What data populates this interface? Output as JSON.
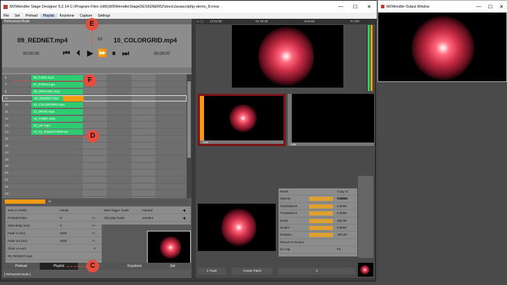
{
  "window": {
    "title": "MXWendler Stage Designer 5.2.14 C:\\Program Files (x86)\\MXWendlerStageDESIGNER52\\docs\\Javascript\\js-demo_8.mxw",
    "min": "—",
    "max": "☐",
    "close": "✕"
  },
  "menu": [
    "File",
    "Set",
    "Preload",
    "Playlist",
    "Keystone",
    "Capture",
    "Settings"
  ],
  "menu_active": "Playlist",
  "left": {
    "mode": "Rehearsal Mode",
    "clip_current": "09_REDNET.mp4",
    "clip_next": "10_COLORGRID.mp4",
    "index": "10",
    "time_current": "00:00:00",
    "time_next": "00:00:07",
    "rows": [
      {
        "n": "6",
        "clip": "06_FADE.mp4"
      },
      {
        "n": "7",
        "clip": "07_PIPES.mp4"
      },
      {
        "n": "8",
        "clip": "08_ORGANIC.mp4"
      },
      {
        "n": "9",
        "clip": "09_REDNET.mp4"
      },
      {
        "n": "10",
        "clip": "10_COLORGRID.mp4"
      },
      {
        "n": "11",
        "clip": "11_DROS.mp4"
      },
      {
        "n": "12",
        "clip": "12_CUBIC.mp4"
      },
      {
        "n": "13",
        "clip": "13_US.mp4"
      },
      {
        "n": "14",
        "clip": "14_14_KeyedLTHEM.avi"
      },
      {
        "n": "15",
        "clip": ""
      },
      {
        "n": "16",
        "clip": ""
      },
      {
        "n": "17",
        "clip": ""
      },
      {
        "n": "18",
        "clip": ""
      },
      {
        "n": "19",
        "clip": ""
      },
      {
        "n": "20",
        "clip": ""
      },
      {
        "n": "21",
        "clip": ""
      },
      {
        "n": "22",
        "clip": ""
      },
      {
        "n": "23",
        "clip": ""
      }
    ],
    "scroll_label": "16",
    "props": [
      {
        "label": "Text or media",
        "value": "media",
        "arrow": ""
      },
      {
        "label": "Preload Index",
        "value": "9",
        "arrow": "+ -"
      },
      {
        "label": "Start delay (ms)",
        "value": "0",
        "arrow": "+ -"
      },
      {
        "label": "Fade in (ms)",
        "value": "2000",
        "arrow": "+ -"
      },
      {
        "label": "Fade out (ms)",
        "value": "2000",
        "arrow": "+ -"
      },
      {
        "label": "Clear on end",
        "value": "",
        "arrow": "✓"
      },
      {
        "label": "09_REDNET.mp4",
        "value": "",
        "arrow": ""
      }
    ],
    "props2": [
      {
        "label": "Start trigger mode",
        "value": "manual"
      },
      {
        "label": "Clip play mode",
        "value": "oneshot"
      }
    ],
    "tabs": [
      "Preload",
      "Playlist",
      "Bar",
      "Keystone",
      "Set"
    ],
    "tab_active": "Playlist",
    "status": "[ Rehearsal Mode ]"
  },
  "right": {
    "head": {
      "t1": "12:51:50",
      "t2": "01:49:48",
      "mode": "Normal",
      "pct": "% 100"
    },
    "tile1_label": "Safe",
    "tile2_label": "Safe",
    "props": [
      {
        "label": "Reset",
        "value": "Copy to Preload"
      },
      {
        "label": "Opacity",
        "value": "1.0000"
      },
      {
        "label": "TranslationX",
        "value": "0.0000"
      },
      {
        "label": "TranslationY",
        "value": "0.0000"
      },
      {
        "label": "Scale",
        "value": "100.00"
      },
      {
        "label": "ScaleY",
        "value": "0.5000"
      },
      {
        "label": "Rotation",
        "value": "180.00"
      },
      {
        "label": "Picture In Picture",
        "value": ""
      },
      {
        "label": "No mip",
        "value": "Fit"
      }
    ],
    "btns": [
      "1 Track",
      "Create Patch",
      "X"
    ]
  },
  "output": {
    "title": "MXWendler Output Window",
    "min": "—",
    "max": "☐",
    "close": "✕"
  },
  "markers": [
    "E",
    "F",
    "D",
    "C"
  ]
}
